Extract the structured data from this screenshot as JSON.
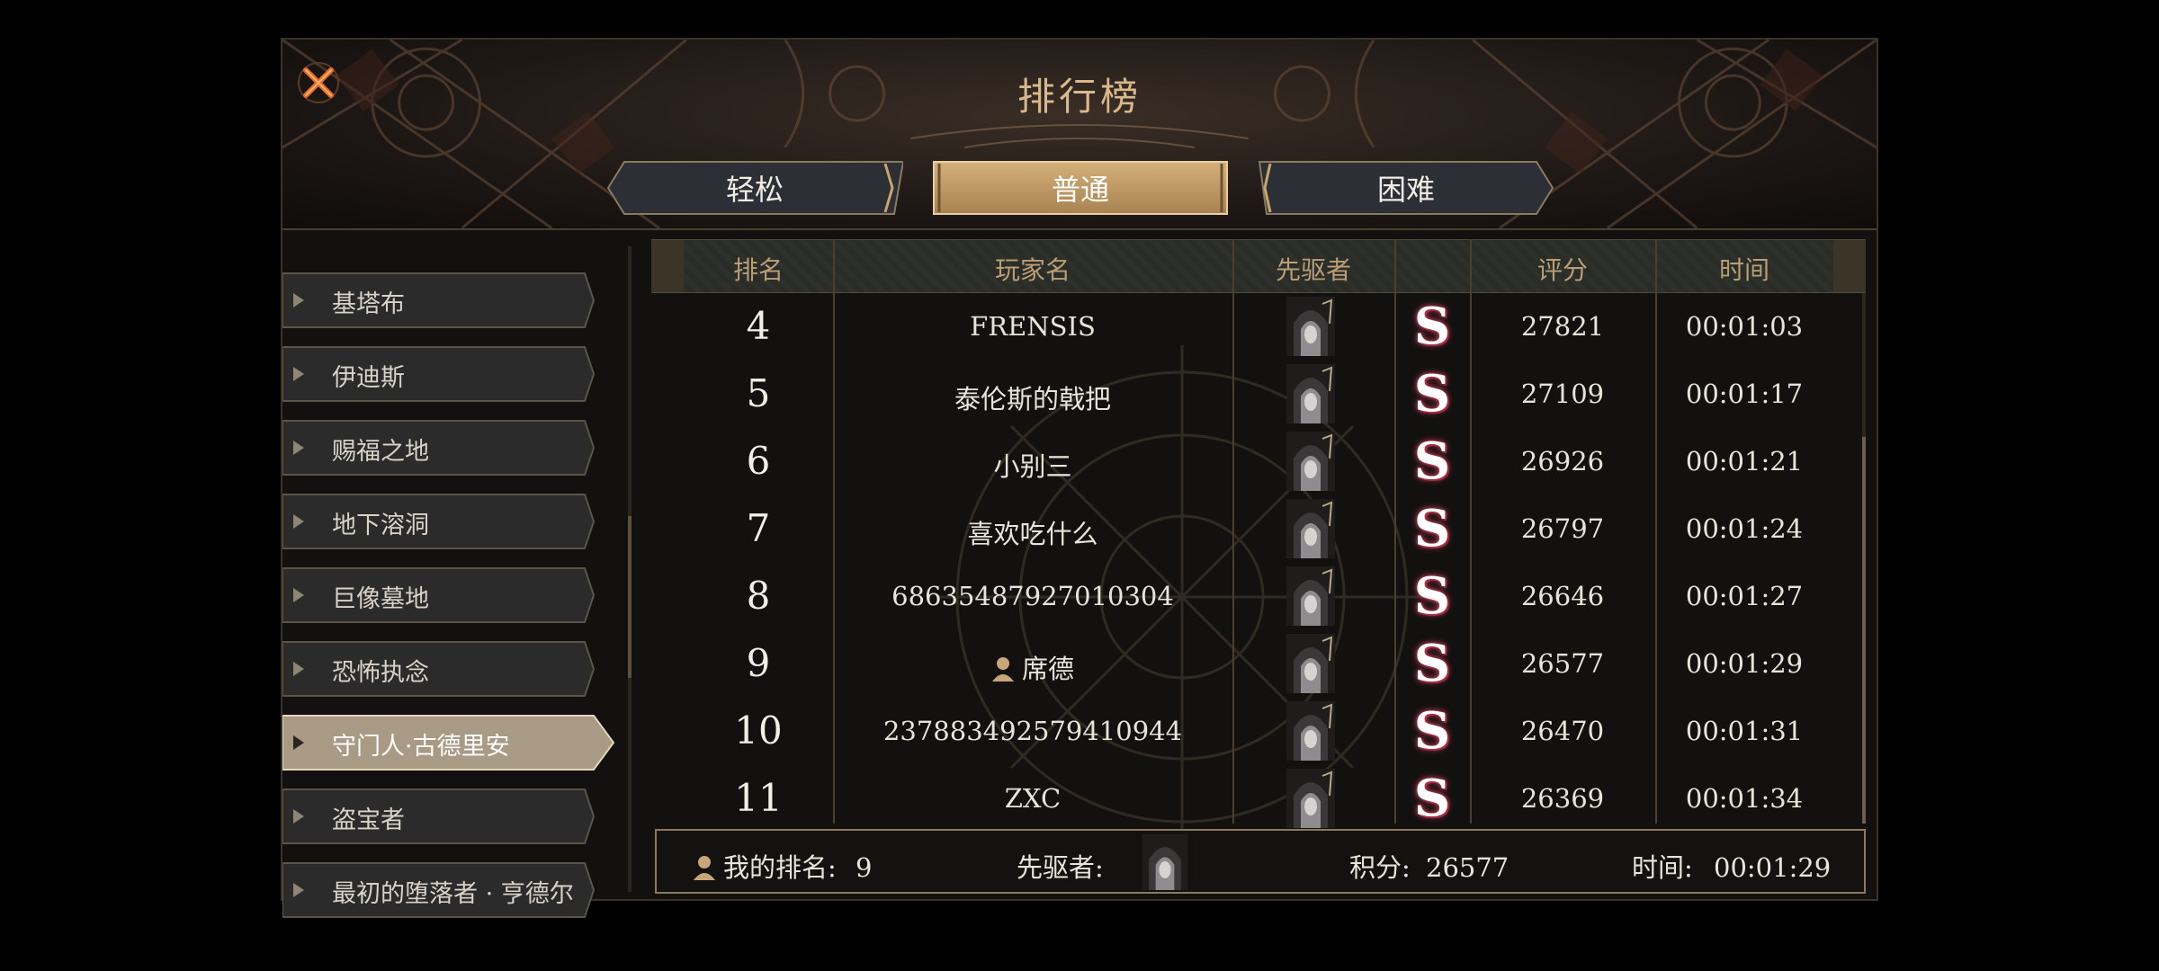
{
  "header": {
    "title": "排行榜"
  },
  "tabs": [
    {
      "label": "轻松",
      "active": false
    },
    {
      "label": "普通",
      "active": true
    },
    {
      "label": "困难",
      "active": false
    }
  ],
  "sidebar": {
    "items": [
      {
        "label": "基塔布"
      },
      {
        "label": "伊迪斯"
      },
      {
        "label": "赐福之地"
      },
      {
        "label": "地下溶洞"
      },
      {
        "label": "巨像墓地"
      },
      {
        "label": "恐怖执念"
      },
      {
        "label": "守门人·古德里安",
        "active": true
      },
      {
        "label": "盗宝者"
      },
      {
        "label": "最初的堕落者 · 亨德尔"
      }
    ]
  },
  "table": {
    "headers": {
      "rank": "排名",
      "player": "玩家名",
      "pioneer": "先驱者",
      "score": "评分",
      "time": "时间"
    },
    "rows": [
      {
        "rank": "4",
        "player": "FRENSIS",
        "grade": "S",
        "score": "27821",
        "time": "00:01:03"
      },
      {
        "rank": "5",
        "player": "泰伦斯的戟把",
        "grade": "S",
        "score": "27109",
        "time": "00:01:17"
      },
      {
        "rank": "6",
        "player": "小别三",
        "grade": "S",
        "score": "26926",
        "time": "00:01:21"
      },
      {
        "rank": "7",
        "player": "喜欢吃什么",
        "grade": "S",
        "score": "26797",
        "time": "00:01:24"
      },
      {
        "rank": "8",
        "player": "68635487927010304",
        "grade": "S",
        "score": "26646",
        "time": "00:01:27"
      },
      {
        "rank": "9",
        "player": "席德",
        "grade": "S",
        "score": "26577",
        "time": "00:01:29",
        "is_me": true
      },
      {
        "rank": "10",
        "player": "237883492579410944",
        "grade": "S",
        "score": "26470",
        "time": "00:01:31"
      },
      {
        "rank": "11",
        "player": "ZXC",
        "grade": "S",
        "score": "26369",
        "time": "00:01:34"
      }
    ]
  },
  "my_rank": {
    "rank_label": "我的排名:",
    "rank_value": "9",
    "pioneer_label": "先驱者:",
    "score_label": "积分:",
    "score_value": "26577",
    "time_label": "时间:",
    "time_value": "00:01:29"
  },
  "colors": {
    "accent_gold": "#d9b98c",
    "active_tab": "#c9a46c",
    "grade_glow": "#c43c56"
  },
  "icons": {
    "close": "close-x-icon",
    "user": "person-icon",
    "avatar": "hooded-pioneer-avatar"
  }
}
